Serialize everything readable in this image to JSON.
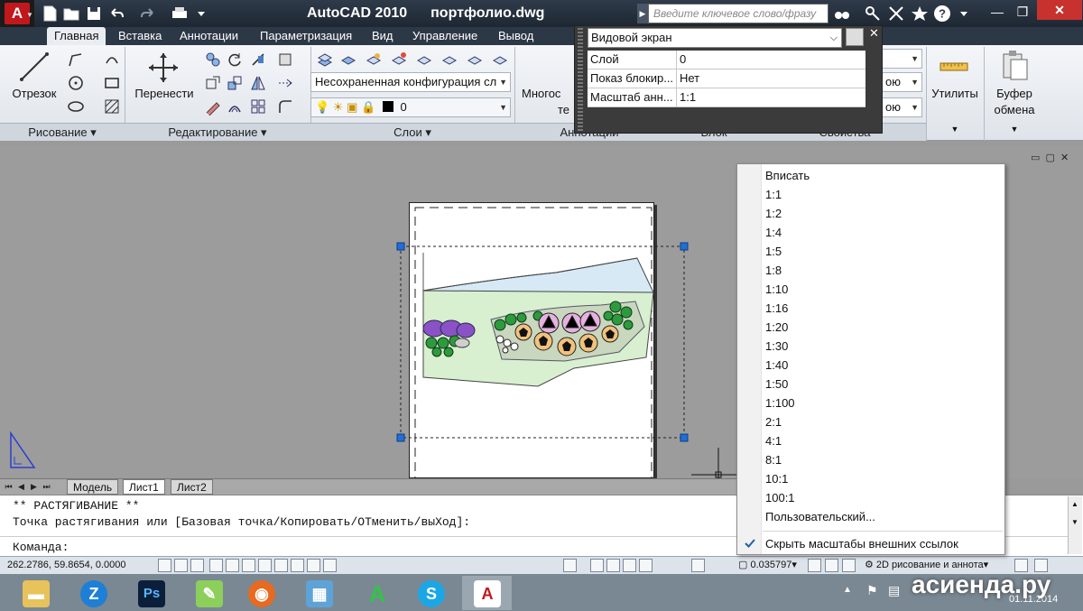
{
  "title": {
    "app": "AutoCAD 2010",
    "file": "портфолио.dwg",
    "search_placeholder": "Введите ключевое слово/фразу"
  },
  "ribbon_tabs": [
    "Главная",
    "Вставка",
    "Аннотации",
    "Параметризация",
    "Вид",
    "Управление",
    "Вывод"
  ],
  "ribbon": {
    "draw": {
      "line_label": "Отрезок",
      "panel": "Рисование ▾"
    },
    "modify": {
      "move_label": "Перенести",
      "panel": "Редактирование ▾"
    },
    "layers": {
      "config": "Несохраненная конфигурация сл",
      "current_layer": "0",
      "panel": "Слои ▾"
    },
    "annotation": {
      "multi_label": "Многос",
      "multi_label2": "те",
      "panel": "Аннотации"
    },
    "block": {
      "panel": "Блок"
    },
    "properties": {
      "combo1": "ою",
      "combo2": "ою",
      "panel": "Свойства"
    },
    "utilities": {
      "label": "Утилиты"
    },
    "clipboard": {
      "label1": "Буфер",
      "label2": "обмена"
    }
  },
  "quick_props": {
    "object": "Видовой экран",
    "rows": [
      {
        "key": "Слой",
        "value": "0"
      },
      {
        "key": "Показ блокир...",
        "value": "Нет"
      },
      {
        "key": "Масштаб анн...",
        "value": "1:1"
      }
    ]
  },
  "layout_tabs": [
    "Модель",
    "Лист1",
    "Лист2"
  ],
  "active_layout": "Лист1",
  "command": {
    "line1": "** РАСТЯГИВАНИЕ **",
    "line2": "Точка растягивания или [Базовая точка/Копировать/ОТменить/выХод]:",
    "prompt": "Команда:"
  },
  "status": {
    "coords": "262.2786, 59.8654, 0.0000",
    "viewport_scale": "0.035797",
    "workspace": "2D рисование и аннота"
  },
  "scale_menu": {
    "items": [
      "Вписать",
      "1:1",
      "1:2",
      "1:4",
      "1:5",
      "1:8",
      "1:10",
      "1:16",
      "1:20",
      "1:30",
      "1:40",
      "1:50",
      "1:100",
      "2:1",
      "4:1",
      "8:1",
      "10:1",
      "100:1",
      "Пользовательский..."
    ],
    "toggle": "Скрыть масштабы внешних ссылок",
    "toggle_checked": true
  },
  "taskbar": {
    "apps": [
      "explorer-icon",
      "zoom-icon",
      "photoshop-icon",
      "notepad-icon",
      "firefox-icon",
      "photo-viewer-icon",
      "archicad-icon",
      "skype-icon",
      "autocad-icon"
    ],
    "clock": "01.11.2014"
  },
  "watermark": "асиенда.ру",
  "colors": {
    "title_bg": "#2f3b4a",
    "ribbon_bg": "#e9edf2",
    "accent_red": "#c0181c",
    "grip_blue": "#1f6fd6",
    "water": "#d6e9f5",
    "lawn": "#d8efd0",
    "tree_green": "#2e9a3e",
    "shrub_purple": "#8a52c6"
  }
}
